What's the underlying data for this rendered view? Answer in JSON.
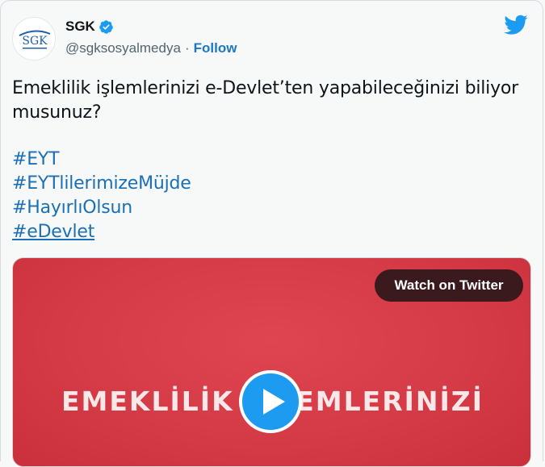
{
  "author": {
    "display_name": "SGK",
    "handle": "@sgksosyalmedya",
    "separator": "·",
    "follow_label": "Follow",
    "avatar_logo_text": "SGK",
    "verified_icon": "verified-badge-icon"
  },
  "tweet": {
    "text": "Emeklilik işlemlerinizi e-Devlet’ten yapabileceğinizi biliyor musunuz?",
    "hashtags": [
      "#EYT",
      "#EYTlilerimizeMüjde",
      "#HayırlıOlsun",
      "#eDevlet"
    ]
  },
  "media": {
    "watch_label": "Watch on Twitter",
    "video_overlay_text": "EMEKLİLİK İŞLEMLERİNİZİ",
    "play_icon": "play-icon"
  },
  "colors": {
    "link": "#1b6fb5",
    "twitter_blue": "#1d9bf0",
    "video_red": "#d53b46"
  }
}
